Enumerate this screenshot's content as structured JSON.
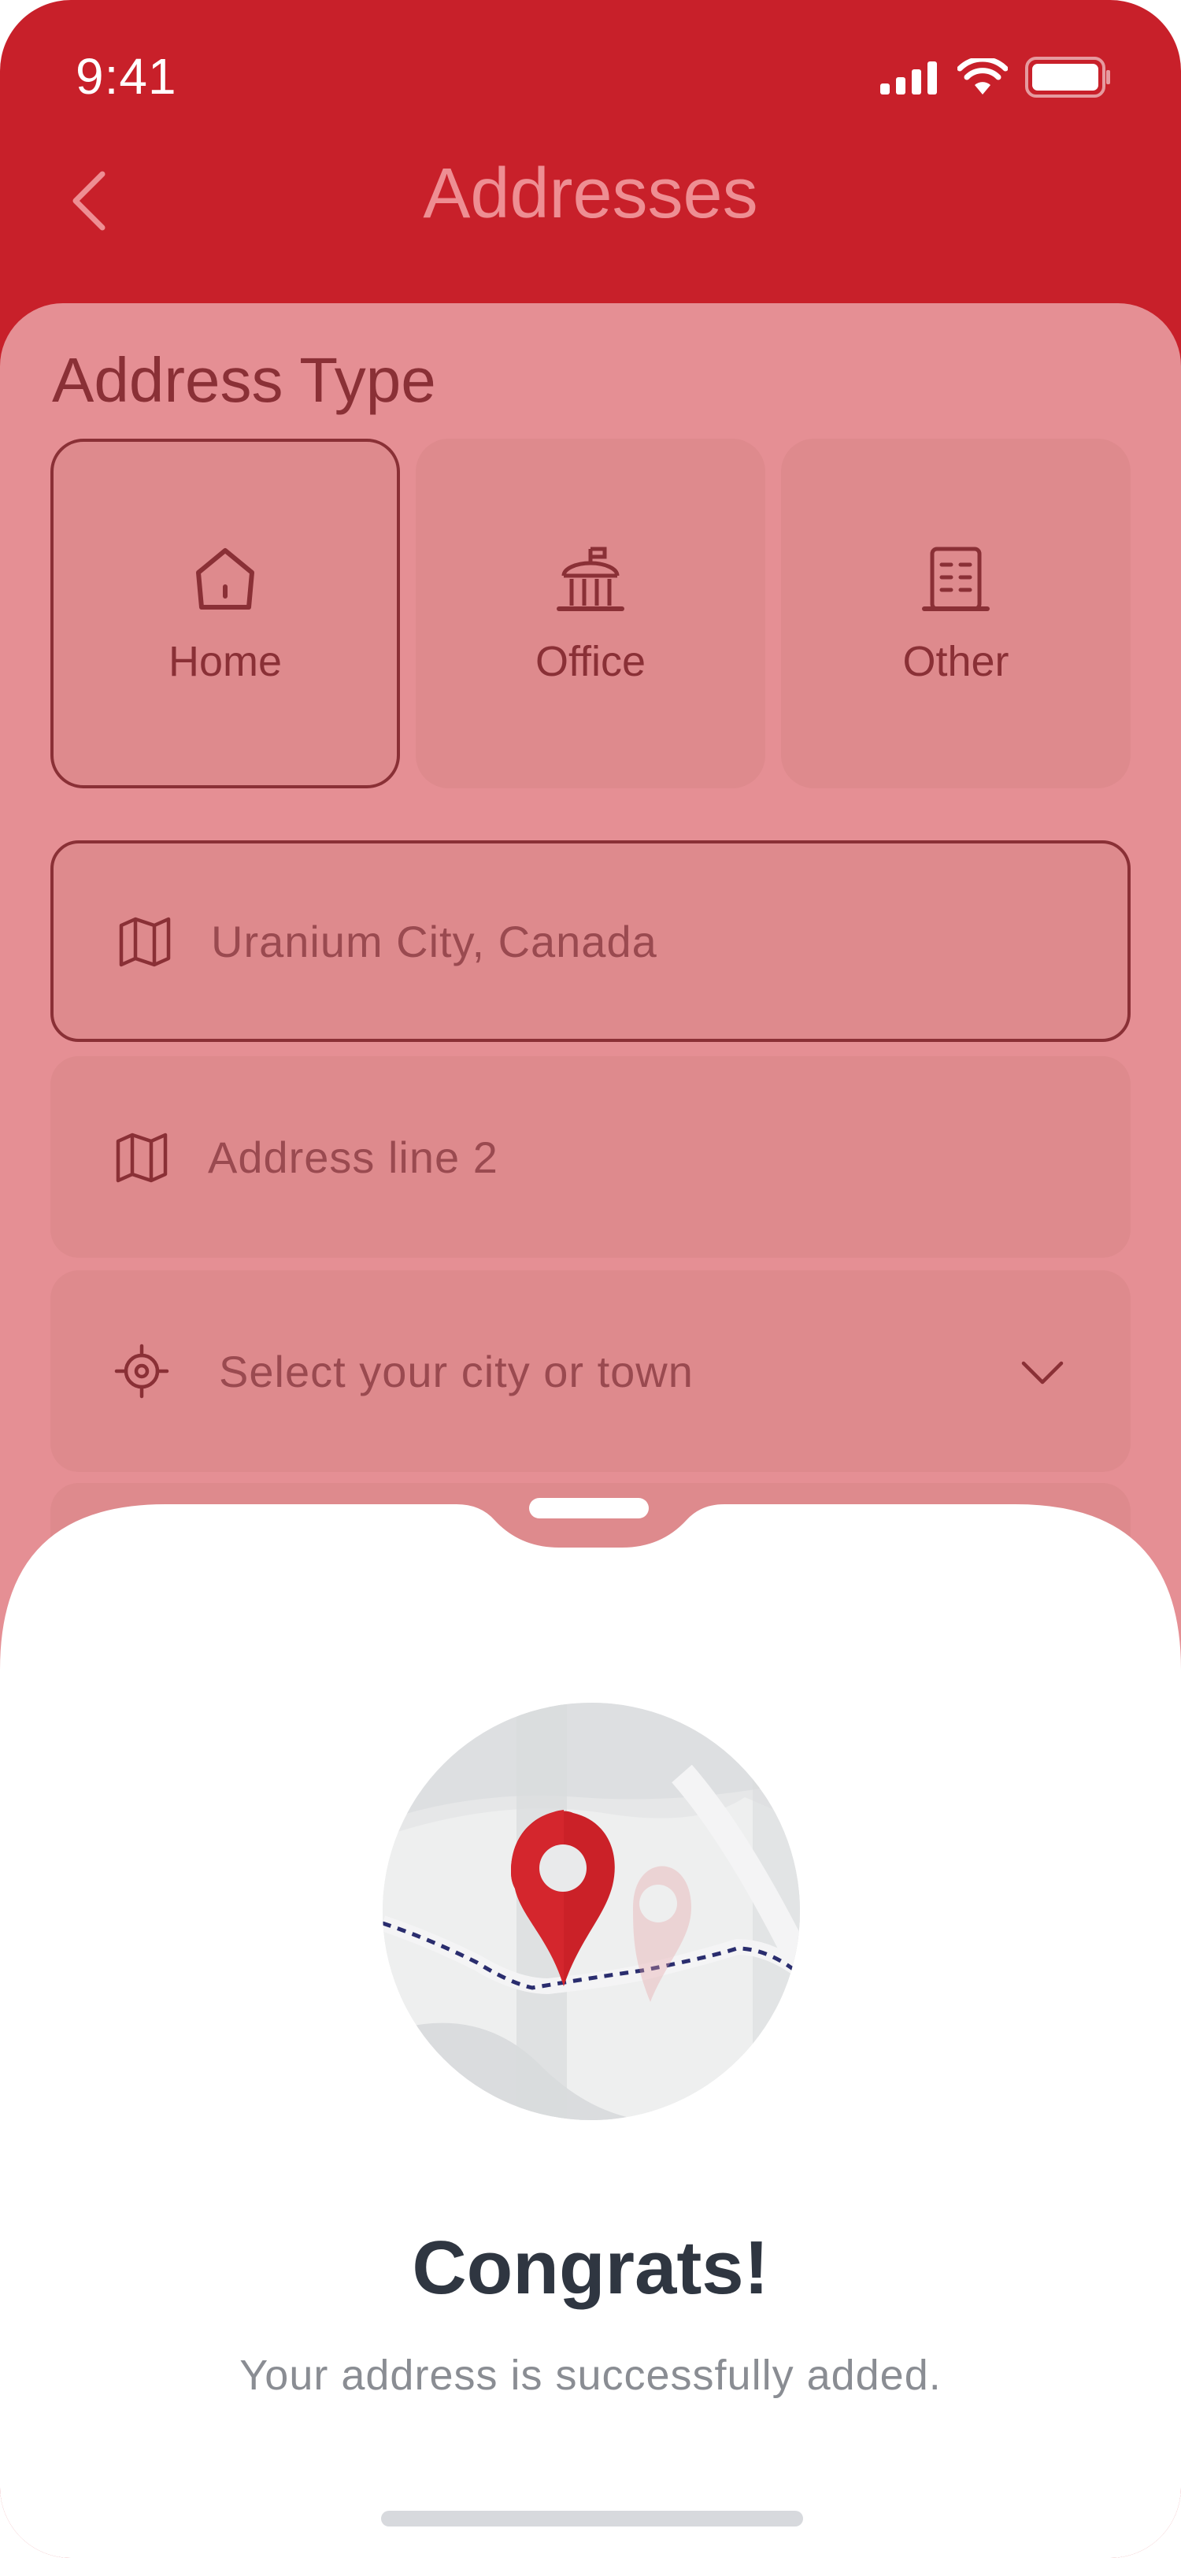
{
  "status_bar": {
    "time": "9:41"
  },
  "header": {
    "title": "Addresses"
  },
  "form": {
    "section_label": "Address Type",
    "address_types": [
      {
        "label": "Home",
        "icon": "home-icon",
        "selected": true
      },
      {
        "label": "Office",
        "icon": "office-building-icon",
        "selected": false
      },
      {
        "label": "Other",
        "icon": "other-building-icon",
        "selected": false
      }
    ],
    "address_line_1": {
      "value": "Uranium City, Canada",
      "icon": "map-icon"
    },
    "address_line_2": {
      "placeholder": "Address line 2",
      "icon": "map-icon"
    },
    "city": {
      "placeholder": "Select your city or town",
      "icon": "location-target-icon"
    }
  },
  "sheet": {
    "title": "Congrats!",
    "message": "Your address is successfully added."
  },
  "colors": {
    "brand_red": "#C8202A",
    "overlay_pink": "#E58F94",
    "dark_text": "#2F3641",
    "muted_text": "#8A8D93"
  }
}
